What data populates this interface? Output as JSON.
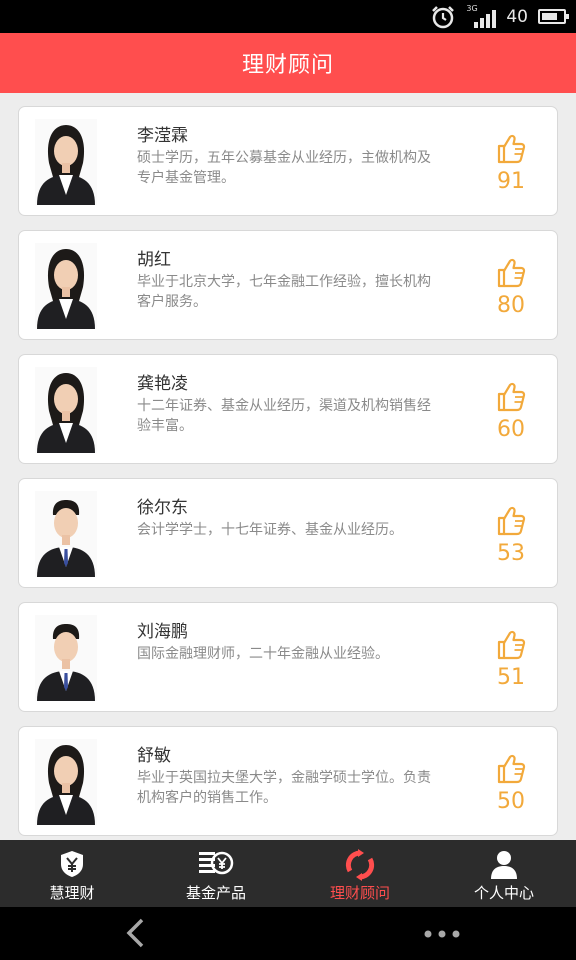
{
  "status_bar": {
    "network": "3G",
    "signal_label": "40",
    "battery_level": 0.75,
    "alarm_icon": "alarm-clock-icon"
  },
  "header": {
    "title": "理财顾问"
  },
  "advisors": [
    {
      "name": "李滢霖",
      "desc": "硕士学历，五年公募基金从业经历，主做机构及专户基金管理。",
      "likes": "91",
      "gender": "female"
    },
    {
      "name": "胡红",
      "desc": "毕业于北京大学，七年金融工作经验，擅长机构客户服务。",
      "likes": "80",
      "gender": "female"
    },
    {
      "name": "龚艳凌",
      "desc": "十二年证券、基金从业经历，渠道及机构销售经验丰富。",
      "likes": "60",
      "gender": "female"
    },
    {
      "name": "徐尔东",
      "desc": "会计学学士，十七年证券、基金从业经历。",
      "likes": "53",
      "gender": "male"
    },
    {
      "name": "刘海鹏",
      "desc": "国际金融理财师，二十年金融从业经验。",
      "likes": "51",
      "gender": "male"
    },
    {
      "name": "舒敏",
      "desc": "毕业于英国拉夫堡大学，金融学硕士学位。负责机构客户的销售工作。",
      "likes": "50",
      "gender": "female"
    }
  ],
  "tabs": [
    {
      "label": "慧理财",
      "icon": "yen-shield-icon"
    },
    {
      "label": "基金产品",
      "icon": "fund-products-icon"
    },
    {
      "label": "理财顾问",
      "icon": "advisor-refresh-icon",
      "active": true
    },
    {
      "label": "个人中心",
      "icon": "person-icon"
    }
  ],
  "colors": {
    "accent": "#ff4e4e",
    "like": "#f2a93b",
    "tabbar": "#2c2c2c"
  }
}
